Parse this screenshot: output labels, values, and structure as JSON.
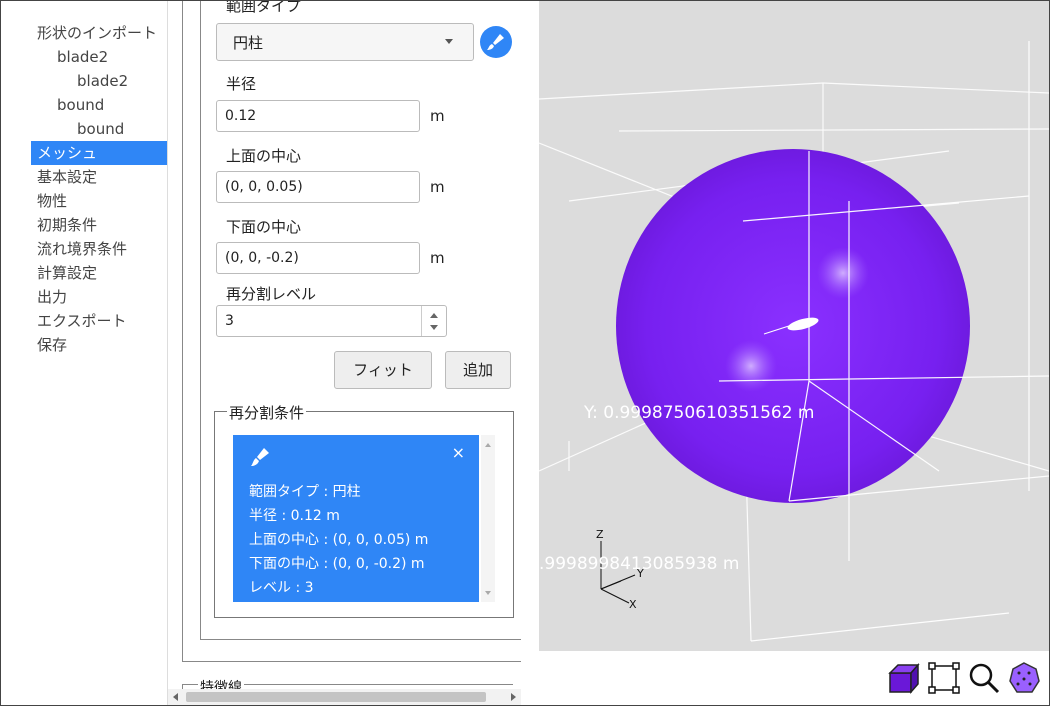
{
  "sidebar": {
    "items": [
      {
        "label": "形状のインポート",
        "indent": 0,
        "active": false
      },
      {
        "label": "blade2",
        "indent": 1,
        "active": false
      },
      {
        "label": "blade2",
        "indent": 2,
        "active": false
      },
      {
        "label": "bound",
        "indent": 1,
        "active": false
      },
      {
        "label": "bound",
        "indent": 2,
        "active": false
      },
      {
        "label": "メッシュ",
        "indent": 0,
        "active": true
      },
      {
        "label": "基本設定",
        "indent": 0,
        "active": false
      },
      {
        "label": "物性",
        "indent": 0,
        "active": false
      },
      {
        "label": "初期条件",
        "indent": 0,
        "active": false
      },
      {
        "label": "流れ境界条件",
        "indent": 0,
        "active": false
      },
      {
        "label": "計算設定",
        "indent": 0,
        "active": false
      },
      {
        "label": "出力",
        "indent": 0,
        "active": false
      },
      {
        "label": "エクスポート",
        "indent": 0,
        "active": false
      },
      {
        "label": "保存",
        "indent": 0,
        "active": false
      }
    ]
  },
  "form": {
    "range_type_label": "範囲タイプ",
    "range_type_value": "円柱",
    "radius_label": "半径",
    "radius_value": "0.12",
    "radius_unit": "m",
    "top_center_label": "上面の中心",
    "top_center_value": "(0, 0, 0.05)",
    "top_center_unit": "m",
    "bottom_center_label": "下面の中心",
    "bottom_center_value": "(0, 0, -0.2)",
    "bottom_center_unit": "m",
    "level_label": "再分割レベル",
    "level_value": "3",
    "fit_button": "フィット",
    "add_button": "追加"
  },
  "conditions": {
    "legend": "再分割条件",
    "items": [
      {
        "close": "×",
        "lines": [
          "範囲タイプ : 円柱",
          "半径 : 0.12 m",
          "上面の中心 : (0, 0, 0.05) m",
          "下面の中心 : (0, 0, -0.2) m",
          "レベル : 3"
        ]
      }
    ]
  },
  "next_section_legend": "特徴線",
  "viewport": {
    "y_label": "Y: 0.9998750610351562 m",
    "x_label": ".9998998413085938 m",
    "axis_z": "Z",
    "axis_y": "Y",
    "axis_x": "X",
    "sphere_color": "#7a22f2",
    "background": "#dcdcdc"
  },
  "toolbar": {
    "icons": [
      "box-view-icon",
      "fit-frame-icon",
      "zoom-icon",
      "mesh-sphere-icon"
    ]
  },
  "colors": {
    "accent": "#2f86f6"
  }
}
